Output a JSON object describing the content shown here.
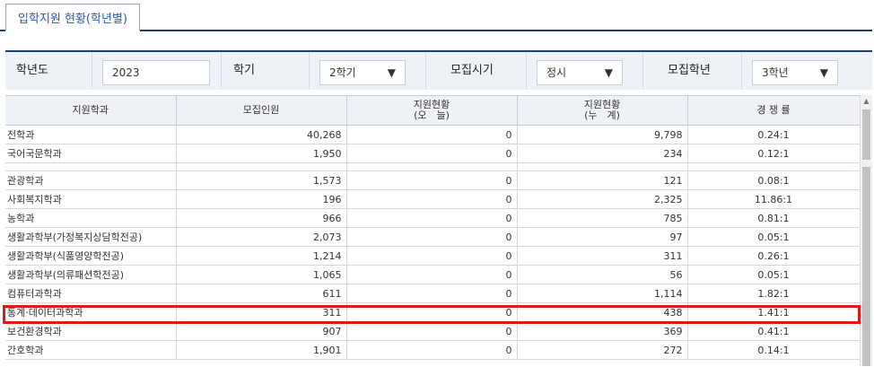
{
  "tab": {
    "label": "입학지원 현황(학년별)"
  },
  "filters": {
    "year_label": "학년도",
    "year_value": "2023",
    "term_label": "학기",
    "term_value": "2학기",
    "period_label": "모집시기",
    "period_value": "정시",
    "grade_label": "모집학년",
    "grade_value": "3학년",
    "dropdown_arrow": "▼"
  },
  "table": {
    "headers": {
      "dept": "지원학과",
      "quota": "모집인원",
      "today_line1": "지원현황",
      "today_line2": "(오　늘)",
      "total_line1": "지원현황",
      "total_line2": "(누　계)",
      "rate": "경 쟁 률"
    },
    "top_rows": [
      {
        "dept": "전학과",
        "quota": "40,268",
        "today": "0",
        "total": "9,798",
        "rate": "0.24:1"
      },
      {
        "dept": "국어국문학과",
        "quota": "1,950",
        "today": "0",
        "total": "234",
        "rate": "0.12:1"
      }
    ],
    "rows": [
      {
        "dept": "관광학과",
        "quota": "1,573",
        "today": "0",
        "total": "121",
        "rate": "0.08:1"
      },
      {
        "dept": "사회복지학과",
        "quota": "196",
        "today": "0",
        "total": "2,325",
        "rate": "11.86:1"
      },
      {
        "dept": "농학과",
        "quota": "966",
        "today": "0",
        "total": "785",
        "rate": "0.81:1"
      },
      {
        "dept": "생활과학부(가정복지상담학전공)",
        "quota": "2,073",
        "today": "0",
        "total": "97",
        "rate": "0.05:1"
      },
      {
        "dept": "생활과학부(식품영양학전공)",
        "quota": "1,214",
        "today": "0",
        "total": "311",
        "rate": "0.26:1"
      },
      {
        "dept": "생활과학부(의류패션학전공)",
        "quota": "1,065",
        "today": "0",
        "total": "56",
        "rate": "0.05:1"
      },
      {
        "dept": "컴퓨터과학과",
        "quota": "611",
        "today": "0",
        "total": "1,114",
        "rate": "1.82:1"
      },
      {
        "dept": "통계·데이터과학과",
        "quota": "311",
        "today": "0",
        "total": "438",
        "rate": "1.41:1"
      },
      {
        "dept": "보건환경학과",
        "quota": "907",
        "today": "0",
        "total": "369",
        "rate": "0.41:1"
      },
      {
        "dept": "간호학과",
        "quota": "1,901",
        "today": "0",
        "total": "272",
        "rate": "0.14:1"
      }
    ]
  },
  "highlight_color": "#e01a1a",
  "accent_color": "#1f3f7a"
}
